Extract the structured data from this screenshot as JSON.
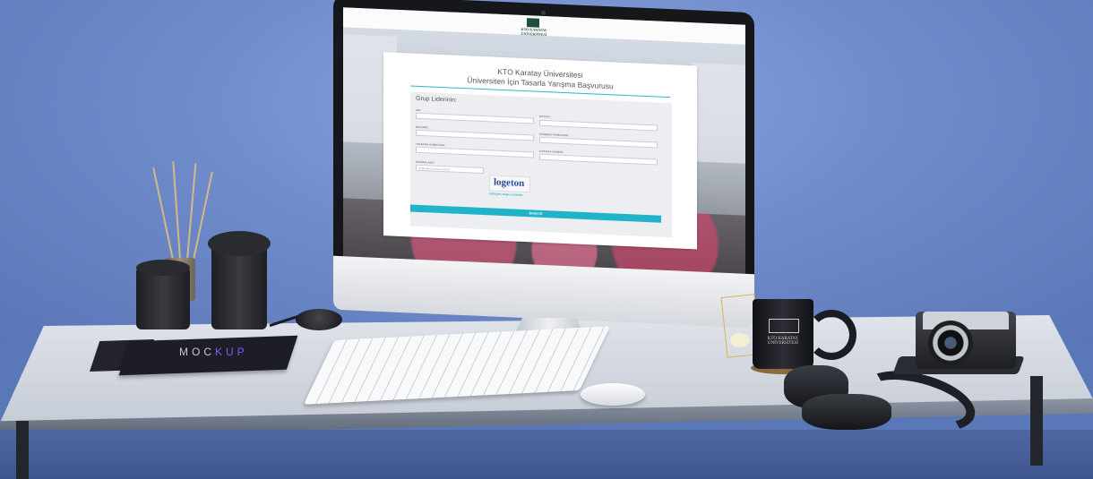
{
  "screen": {
    "logo_text": "KTO KARATAY ÜNİVERSİTESİ",
    "form": {
      "title": "KTO Karatay Üniversitesi",
      "subtitle": "Üniversiten İçin Tasarla Yarışma Başvurusu",
      "group_title": "Grup Liderinin:",
      "fields": {
        "ad_label": "ADI:",
        "soyad_label": "SOYADI:",
        "bolum_label": "BÖLÜMÜ:",
        "ogrenci_no_label": "ÖĞRENCİ NUMARASI:",
        "telefon_label": "TELEFON NUMARASI:",
        "eposta_label": "E-POSTA ADRESİ:",
        "dogrulama_label": "DOĞRULAMA:",
        "dogrulama_placeholder": "Doğrulama Kodunu Giriniz"
      },
      "captcha_text": "logeton",
      "refresh_label": "DEĞİŞTİR, BAŞKA GÖSTER",
      "submit_label": "BAŞVUR"
    }
  },
  "props": {
    "book_text_main": "MOC",
    "book_text_accent": "KUP",
    "mug_text": "KTO KARATAY ÜNİVERSİTESİ"
  },
  "colors": {
    "accent": "#21b3c7",
    "wall": "#6f8ccb",
    "brand_green": "#1f4f42"
  }
}
